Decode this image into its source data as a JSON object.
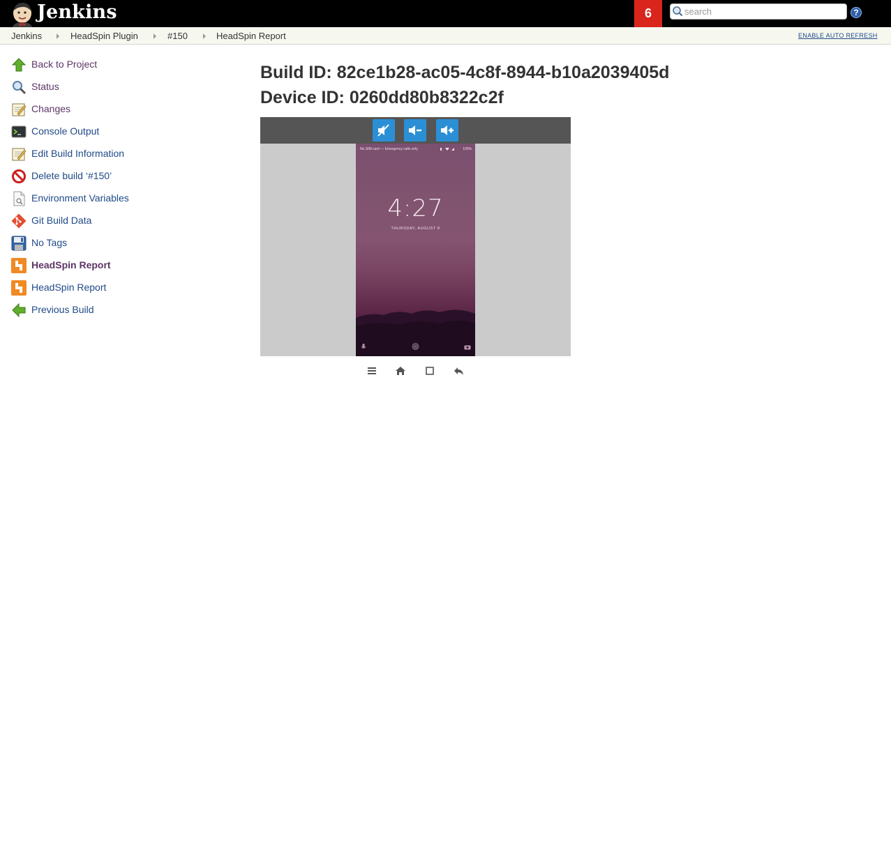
{
  "header": {
    "logo_text": "Jenkins",
    "notification_count": "6",
    "search": {
      "placeholder": "search",
      "value": ""
    },
    "help_label": "?"
  },
  "breadcrumb": {
    "items": [
      "Jenkins",
      "HeadSpin Plugin",
      "#150",
      "HeadSpin Report"
    ],
    "auto_refresh": "ENABLE AUTO REFRESH"
  },
  "sidebar": {
    "items": [
      {
        "label": "Back to Project",
        "icon": "up-arrow-icon"
      },
      {
        "label": "Status",
        "icon": "magnifier-icon"
      },
      {
        "label": "Changes",
        "icon": "notepad-icon"
      },
      {
        "label": "Console Output",
        "icon": "terminal-icon"
      },
      {
        "label": "Edit Build Information",
        "icon": "notepad-icon"
      },
      {
        "label": "Delete build ‘#150’",
        "icon": "no-entry-icon"
      },
      {
        "label": "Environment Variables",
        "icon": "document-search-icon"
      },
      {
        "label": "Git Build Data",
        "icon": "git-icon"
      },
      {
        "label": "No Tags",
        "icon": "floppy-icon"
      },
      {
        "label": "HeadSpin Report",
        "icon": "headspin-icon",
        "active": true
      },
      {
        "label": "HeadSpin Report",
        "icon": "headspin-icon"
      },
      {
        "label": "Previous Build",
        "icon": "left-arrow-icon"
      }
    ]
  },
  "main": {
    "build_id": "Build ID: 82ce1b28-ac05-4c8f-8944-b10a2039405d",
    "device_id": "Device ID: 0260dd80b8322c2f",
    "volume_buttons": [
      "mute-icon",
      "volume-down-icon",
      "volume-up-icon"
    ],
    "phone": {
      "status_text": "No SIM card — Emergency calls only",
      "battery_text": "100%",
      "time": "4:27",
      "date": "THURSDAY, AUGUST 8"
    },
    "nav_buttons": [
      "menu-icon",
      "home-icon",
      "overview-icon",
      "back-icon"
    ]
  },
  "colors": {
    "header_bg": "#000000",
    "badge_red": "#d9251c",
    "link_blue": "#204a87",
    "visited_purple": "#5c3566",
    "volume_button_blue": "#2b8fd6"
  }
}
